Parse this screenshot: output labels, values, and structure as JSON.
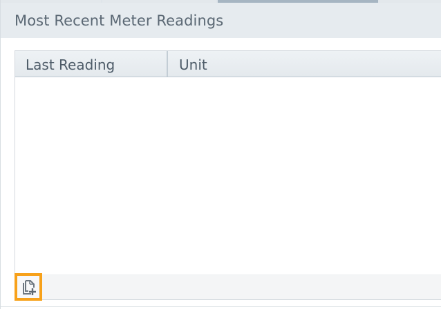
{
  "section": {
    "title": "Most Recent Meter Readings"
  },
  "table": {
    "columns": [
      {
        "label": "Last Reading"
      },
      {
        "label": "Unit"
      }
    ],
    "rows": []
  },
  "toolbar": {
    "add_icon": "add-document-icon",
    "accent_color": "#f7a11a"
  }
}
